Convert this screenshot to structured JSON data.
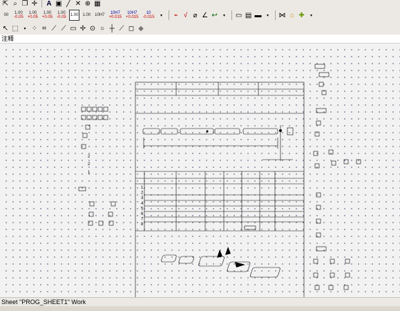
{
  "toolbar_row2": {
    "buttons": [
      {
        "top": "00",
        "bottom": ""
      },
      {
        "top": "1.00",
        "bottom": "-0.05"
      },
      {
        "top": "1.00",
        "bottom": "+0.05"
      },
      {
        "top": "1.00",
        "bottom": "+0.05"
      },
      {
        "top": "1.00",
        "bottom": "-0.05"
      },
      {
        "top": "1.00",
        "bottom": "",
        "boxed": true
      },
      {
        "top": "1.00",
        "bottom": ""
      },
      {
        "top": "10H7",
        "bottom": ""
      },
      {
        "top": "10H7",
        "bottom": "+0.015"
      },
      {
        "top": "10H7",
        "bottom": "+0.015"
      },
      {
        "top": "10",
        "bottom": "-0.015"
      }
    ]
  },
  "header": {
    "title": "注释"
  },
  "drawing": {
    "row_numbers": [
      "1",
      "2",
      "3",
      "4",
      "5",
      "6",
      "7",
      "8"
    ],
    "left_labels": [
      "2",
      "2",
      "1"
    ]
  },
  "status": {
    "text": "Sheet \"PROG_SHEET1\" Work"
  }
}
